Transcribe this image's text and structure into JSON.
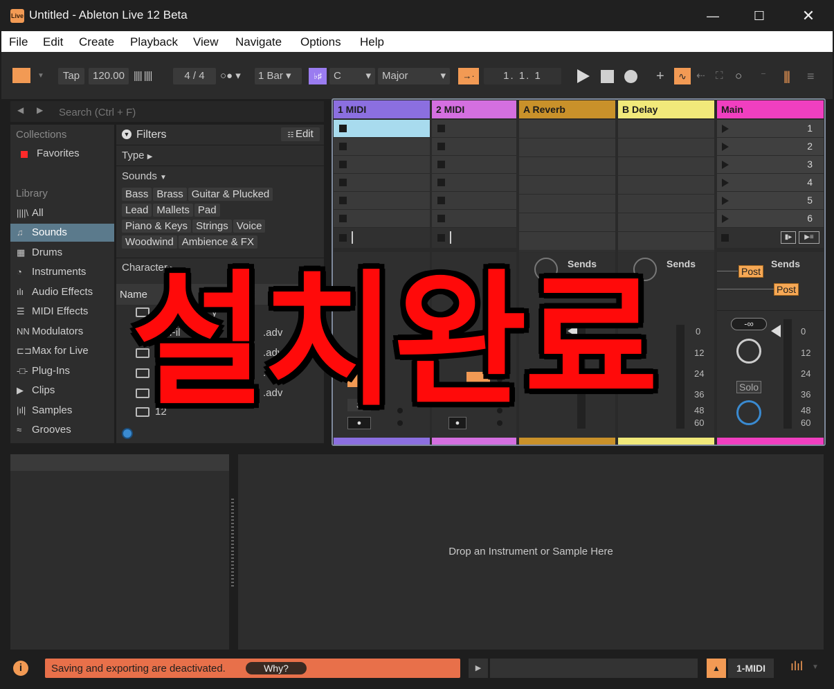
{
  "window": {
    "title": "Untitled - Ableton Live 12 Beta",
    "logo_text": "Live"
  },
  "menu": [
    "File",
    "Edit",
    "Create",
    "Playback",
    "View",
    "Navigate",
    "Options",
    "Help"
  ],
  "toolbar": {
    "tap": "Tap",
    "tempo": "120.00",
    "signature_num": "4",
    "signature_sep": "/",
    "signature_den": "4",
    "quantize": "1 Bar",
    "scale_root": "C",
    "scale_mode": "Major",
    "position": [
      "1.",
      "1.",
      "1"
    ]
  },
  "browser": {
    "search_placeholder": "Search (Ctrl + F)",
    "collections_label": "Collections",
    "favorites": "Favorites",
    "library_label": "Library",
    "library_items": [
      "All",
      "Sounds",
      "Drums",
      "Instruments",
      "Audio Effects",
      "MIDI Effects",
      "Modulators",
      "Max for Live",
      "Plug-Ins",
      "Clips",
      "Samples",
      "Grooves"
    ],
    "filters_label": "Filters",
    "edit_label": "Edit",
    "type_label": "Type",
    "sounds_label": "Sounds",
    "sound_tags": [
      [
        "Bass",
        "Brass",
        "Guitar & Plucked"
      ],
      [
        "Lead",
        "Mallets",
        "Pad"
      ],
      [
        "Piano & Keys",
        "Strings",
        "Voice"
      ],
      [
        "Woodwind",
        "Ambience & FX"
      ]
    ],
    "character_label": "Character",
    "name_header": "Name",
    "file_fragments": [
      "y",
      "s Fil",
      ".adv",
      ".adv",
      ".adv",
      ".adv",
      "12"
    ]
  },
  "session": {
    "tracks": [
      {
        "name": "1 MIDI",
        "color": "#8b6fe0"
      },
      {
        "name": "2 MIDI",
        "color": "#d46fe0"
      },
      {
        "name": "A Reverb",
        "color": "#c9912a"
      },
      {
        "name": "B Delay",
        "color": "#f1e97a"
      },
      {
        "name": "Main",
        "color": "#f03fc0"
      }
    ],
    "scenes": [
      "1",
      "2",
      "3",
      "4",
      "5",
      "6"
    ],
    "sends_label": "Sends",
    "post_label": "Post",
    "send_a": "A",
    "send_b": "B",
    "db_marks": [
      "0",
      "12",
      "24",
      "36",
      "48",
      "60"
    ],
    "inf_label": "-∞",
    "solo_label": "Solo"
  },
  "detail": {
    "drop_hint": "Drop an Instrument or Sample Here"
  },
  "status": {
    "message": "Saving and exporting are deactivated.",
    "why_label": "Why?",
    "track_label": "1-MIDI"
  },
  "overlay": {
    "text": "설치완료"
  },
  "colors": {
    "accent": "#f29a54",
    "warning": "#e8704a",
    "selected_clip": "#a8dbee",
    "overlay_text": "#ff0a0a"
  }
}
